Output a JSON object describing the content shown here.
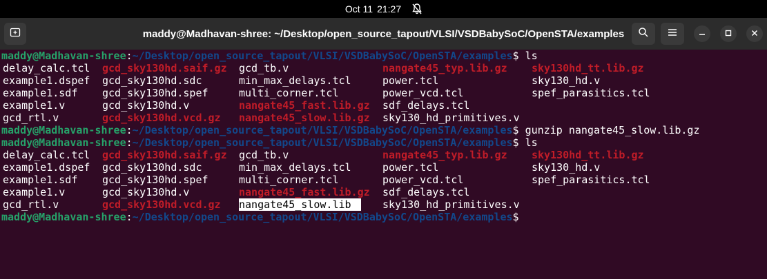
{
  "system_bar": {
    "date": "Oct 11",
    "time": "21:27"
  },
  "window": {
    "title": "maddy@Madhavan-shree: ~/Desktop/open_source_tapout/VLSI/VSDBabySoC/OpenSTA/examples"
  },
  "prompt": {
    "user": "maddy@Madhavan-shree",
    "path": "~/Desktop/open_source_tapout/VLSI/VSDBabySoC/OpenSTA/examples"
  },
  "commands": {
    "ls1": "ls",
    "gunzip": "gunzip nangate45_slow.lib.gz",
    "ls2": "ls",
    "last": ""
  },
  "listing1": [
    [
      {
        "t": "delay_calc.tcl",
        "red": false
      },
      {
        "t": "gcd_sky130hd.saif.gz",
        "red": true
      },
      {
        "t": "gcd_tb.v",
        "red": false
      },
      {
        "t": "nangate45_typ.lib.gz",
        "red": true
      },
      {
        "t": "sky130hd_tt.lib.gz",
        "red": true
      }
    ],
    [
      {
        "t": "example1.dspef",
        "red": false
      },
      {
        "t": "gcd_sky130hd.sdc",
        "red": false
      },
      {
        "t": "min_max_delays.tcl",
        "red": false
      },
      {
        "t": "power.tcl",
        "red": false
      },
      {
        "t": "sky130_hd.v",
        "red": false
      }
    ],
    [
      {
        "t": "example1.sdf",
        "red": false
      },
      {
        "t": "gcd_sky130hd.spef",
        "red": false
      },
      {
        "t": "multi_corner.tcl",
        "red": false
      },
      {
        "t": "power_vcd.tcl",
        "red": false
      },
      {
        "t": "spef_parasitics.tcl",
        "red": false
      }
    ],
    [
      {
        "t": "example1.v",
        "red": false
      },
      {
        "t": "gcd_sky130hd.v",
        "red": false
      },
      {
        "t": "nangate45_fast.lib.gz",
        "red": true
      },
      {
        "t": "sdf_delays.tcl",
        "red": false
      },
      {
        "t": "",
        "red": false
      }
    ],
    [
      {
        "t": "gcd_rtl.v",
        "red": false
      },
      {
        "t": "gcd_sky130hd.vcd.gz",
        "red": true
      },
      {
        "t": "nangate45_slow.lib.gz",
        "red": true
      },
      {
        "t": "sky130_hd_primitives.v",
        "red": false
      },
      {
        "t": "",
        "red": false
      }
    ]
  ],
  "listing2": [
    [
      {
        "t": "delay_calc.tcl",
        "red": false
      },
      {
        "t": "gcd_sky130hd.saif.gz",
        "red": true
      },
      {
        "t": "gcd_tb.v",
        "red": false
      },
      {
        "t": "nangate45_typ.lib.gz",
        "red": true
      },
      {
        "t": "sky130hd_tt.lib.gz",
        "red": true
      }
    ],
    [
      {
        "t": "example1.dspef",
        "red": false
      },
      {
        "t": "gcd_sky130hd.sdc",
        "red": false
      },
      {
        "t": "min_max_delays.tcl",
        "red": false
      },
      {
        "t": "power.tcl",
        "red": false
      },
      {
        "t": "sky130_hd.v",
        "red": false
      }
    ],
    [
      {
        "t": "example1.sdf",
        "red": false
      },
      {
        "t": "gcd_sky130hd.spef",
        "red": false
      },
      {
        "t": "multi_corner.tcl",
        "red": false
      },
      {
        "t": "power_vcd.tcl",
        "red": false
      },
      {
        "t": "spef_parasitics.tcl",
        "red": false
      }
    ],
    [
      {
        "t": "example1.v",
        "red": false
      },
      {
        "t": "gcd_sky130hd.v",
        "red": false
      },
      {
        "t": "nangate45_fast.lib.gz",
        "red": true
      },
      {
        "t": "sdf_delays.tcl",
        "red": false
      },
      {
        "t": "",
        "red": false
      }
    ],
    [
      {
        "t": "gcd_rtl.v",
        "red": false
      },
      {
        "t": "gcd_sky130hd.vcd.gz",
        "red": true
      },
      {
        "t": "nangate45_slow.lib",
        "red": false,
        "highlight": true
      },
      {
        "t": "sky130_hd_primitives.v",
        "red": false
      },
      {
        "t": "",
        "red": false
      }
    ]
  ],
  "icons": {
    "new_tab": "new-tab-icon",
    "search": "search-icon",
    "menu": "hamburger-menu-icon",
    "minimize": "minimize-icon",
    "maximize": "maximize-icon",
    "close": "close-icon",
    "bell": "bell-icon"
  },
  "colors": {
    "terminal_bg": "#300a24",
    "prompt_user": "#26a269",
    "prompt_path": "#12488b",
    "archive_red": "#c01c28"
  }
}
